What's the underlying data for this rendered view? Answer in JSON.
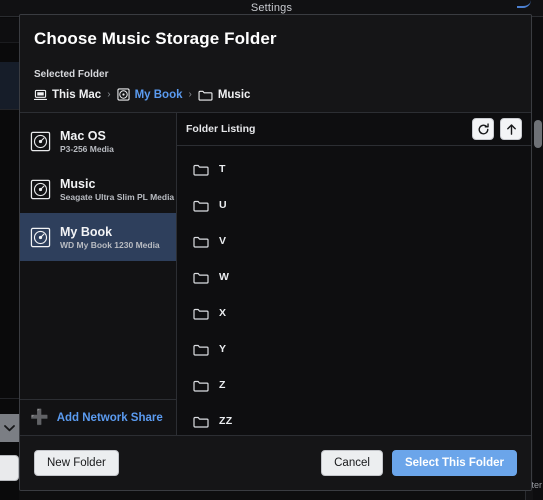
{
  "window": {
    "title": "Settings"
  },
  "dialog": {
    "title": "Choose Music Storage Folder",
    "selected_folder_label": "Selected Folder",
    "breadcrumb": [
      {
        "label": "This Mac",
        "icon": "computer-icon",
        "is_link": false
      },
      {
        "label": "My Book",
        "icon": "disk-icon",
        "is_link": true
      },
      {
        "label": "Music",
        "icon": "folder-icon",
        "is_link": false
      }
    ],
    "breadcrumb_separator": "›"
  },
  "sidebar": {
    "volumes": [
      {
        "name": "Mac OS",
        "subtitle": "P3-256 Media",
        "icon": "disk-icon",
        "selected": false
      },
      {
        "name": "Music",
        "subtitle": "Seagate Ultra Slim PL Media",
        "icon": "disk-icon",
        "selected": false
      },
      {
        "name": "My Book",
        "subtitle": "WD My Book 1230 Media",
        "icon": "disk-icon",
        "selected": true
      }
    ],
    "add_network_share": {
      "label": "Add Network Share",
      "icon": "plus-icon"
    }
  },
  "content": {
    "header_title": "Folder Listing",
    "refresh_button": {
      "icon": "refresh-icon",
      "label": "↻"
    },
    "up_button": {
      "icon": "arrow-up-icon",
      "label": "↑"
    },
    "folders": [
      {
        "name": "T",
        "icon": "folder-icon"
      },
      {
        "name": "U",
        "icon": "folder-icon"
      },
      {
        "name": "V",
        "icon": "folder-icon"
      },
      {
        "name": "W",
        "icon": "folder-icon"
      },
      {
        "name": "X",
        "icon": "folder-icon"
      },
      {
        "name": "Y",
        "icon": "folder-icon"
      },
      {
        "name": "Z",
        "icon": "folder-icon"
      },
      {
        "name": "ZZ",
        "icon": "folder-icon"
      }
    ]
  },
  "footer": {
    "new_folder": "New Folder",
    "cancel": "Cancel",
    "select_this_folder": "Select This Folder"
  },
  "background": {
    "right_edge_text": "ter",
    "dropdown_icon": "chevron-down-icon"
  },
  "colors": {
    "accent_blue": "#5b9bf0",
    "primary_button": "#6ba5ea",
    "selected_row": "#2e3f5c",
    "dialog_bg": "#151517",
    "content_bg": "#0e0e10"
  }
}
